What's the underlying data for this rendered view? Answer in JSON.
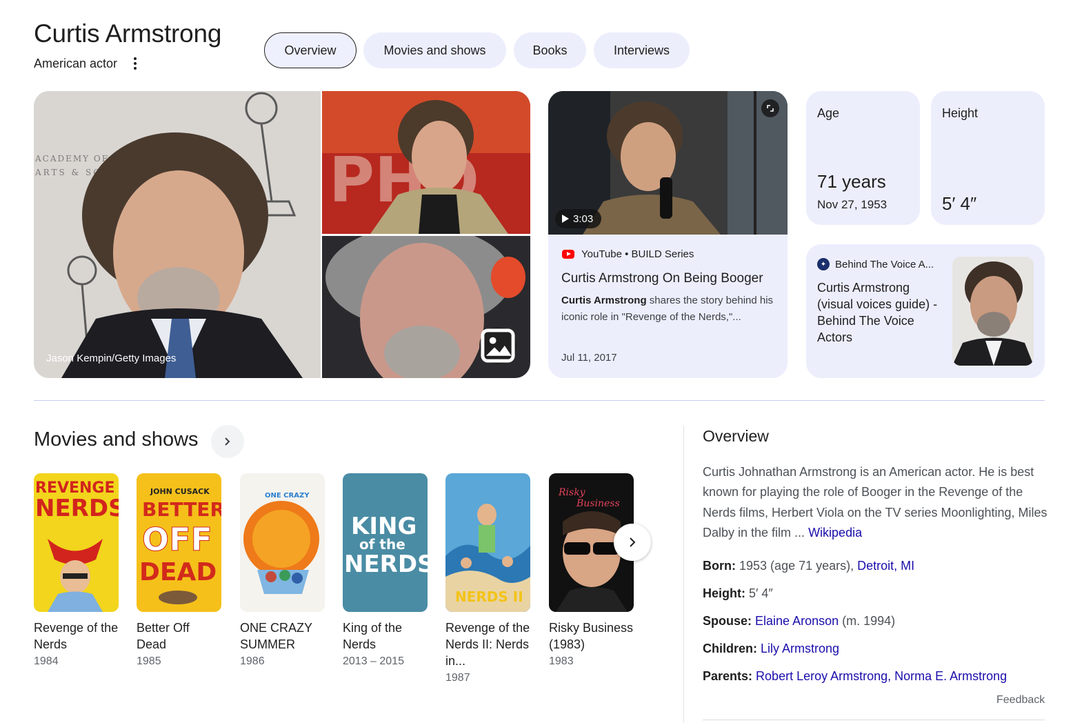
{
  "header": {
    "title": "Curtis Armstrong",
    "subtitle": "American actor",
    "tabs": [
      {
        "label": "Overview",
        "active": true
      },
      {
        "label": "Movies and shows",
        "active": false
      },
      {
        "label": "Books",
        "active": false
      },
      {
        "label": "Interviews",
        "active": false
      }
    ]
  },
  "images": {
    "credit": "Jason Kempin/Getty Images",
    "gallery_icon": "image-gallery-icon"
  },
  "video": {
    "duration": "3:03",
    "source": "YouTube • BUILD Series",
    "title": "Curtis Armstrong On Being Booger",
    "snippet_bold": "Curtis Armstrong",
    "snippet_rest": " shares the story behind his iconic role in \"Revenge of the Nerds,\"...",
    "date": "Jul 11, 2017"
  },
  "facts": {
    "age": {
      "label": "Age",
      "value": "71 years",
      "sub": "Nov 27, 1953"
    },
    "height": {
      "label": "Height",
      "value": "5′ 4″"
    }
  },
  "article": {
    "source": "Behind The Voice A...",
    "title": "Curtis Armstrong (visual voices guide) - Behind The Voice Actors"
  },
  "movies": {
    "section_title": "Movies and shows",
    "items": [
      {
        "title": "Revenge of the Nerds",
        "year": "1984"
      },
      {
        "title": "Better Off Dead",
        "year": "1985"
      },
      {
        "title": "ONE CRAZY SUMMER",
        "year": "1986"
      },
      {
        "title": "King of the Nerds",
        "year": "2013 – 2015"
      },
      {
        "title": "Revenge of the Nerds II: Nerds in...",
        "year": "1987"
      },
      {
        "title": "Risky Business (1983)",
        "year": "1983"
      }
    ]
  },
  "overview": {
    "title": "Overview",
    "text": "Curtis Johnathan Armstrong is an American actor. He is best known for playing the role of Booger in the Revenge of the Nerds films, Herbert Viola on the TV series Moonlighting, Miles Dalby in the film ... ",
    "wiki_link": "Wikipedia",
    "born_label": "Born:",
    "born_text": "1953 (age 71 years), ",
    "born_link": "Detroit, MI",
    "height_label": "Height:",
    "height_text": "5′ 4″",
    "spouse_label": "Spouse:",
    "spouse_link": "Elaine Aronson",
    "spouse_text": " (m. 1994)",
    "children_label": "Children:",
    "children_link": "Lily Armstrong",
    "parents_label": "Parents:",
    "parents_link": "Robert Leroy Armstrong, Norma E. Armstrong",
    "feedback": "Feedback"
  },
  "colors": {
    "chip_bg": "#eceefc",
    "link": "#1a0dab",
    "divider": "#c6cdf0"
  }
}
